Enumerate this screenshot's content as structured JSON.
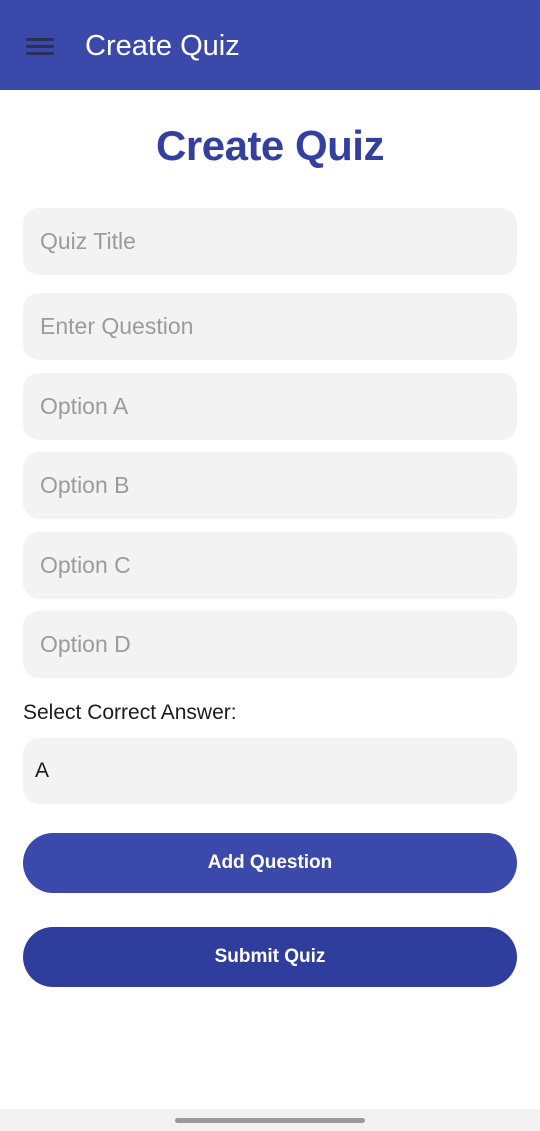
{
  "app_bar": {
    "title": "Create Quiz",
    "background": "#3b4aaa",
    "menu_icon": "hamburger-menu-icon"
  },
  "page": {
    "heading": "Create Quiz",
    "heading_color": "#3340a0"
  },
  "form": {
    "quiz_title": {
      "placeholder": "Quiz Title",
      "value": ""
    },
    "question": {
      "placeholder": "Enter Question",
      "value": ""
    },
    "option_a": {
      "placeholder": "Option A",
      "value": ""
    },
    "option_b": {
      "placeholder": "Option B",
      "value": ""
    },
    "option_c": {
      "placeholder": "Option C",
      "value": ""
    },
    "option_d": {
      "placeholder": "Option D",
      "value": ""
    },
    "correct_answer_label": "Select Correct Answer:",
    "correct_answer_selected": "A"
  },
  "buttons": {
    "add_question": "Add Question",
    "submit_quiz": "Submit Quiz",
    "add_color": "#3b4aaa",
    "submit_color": "#2f3d9d"
  }
}
